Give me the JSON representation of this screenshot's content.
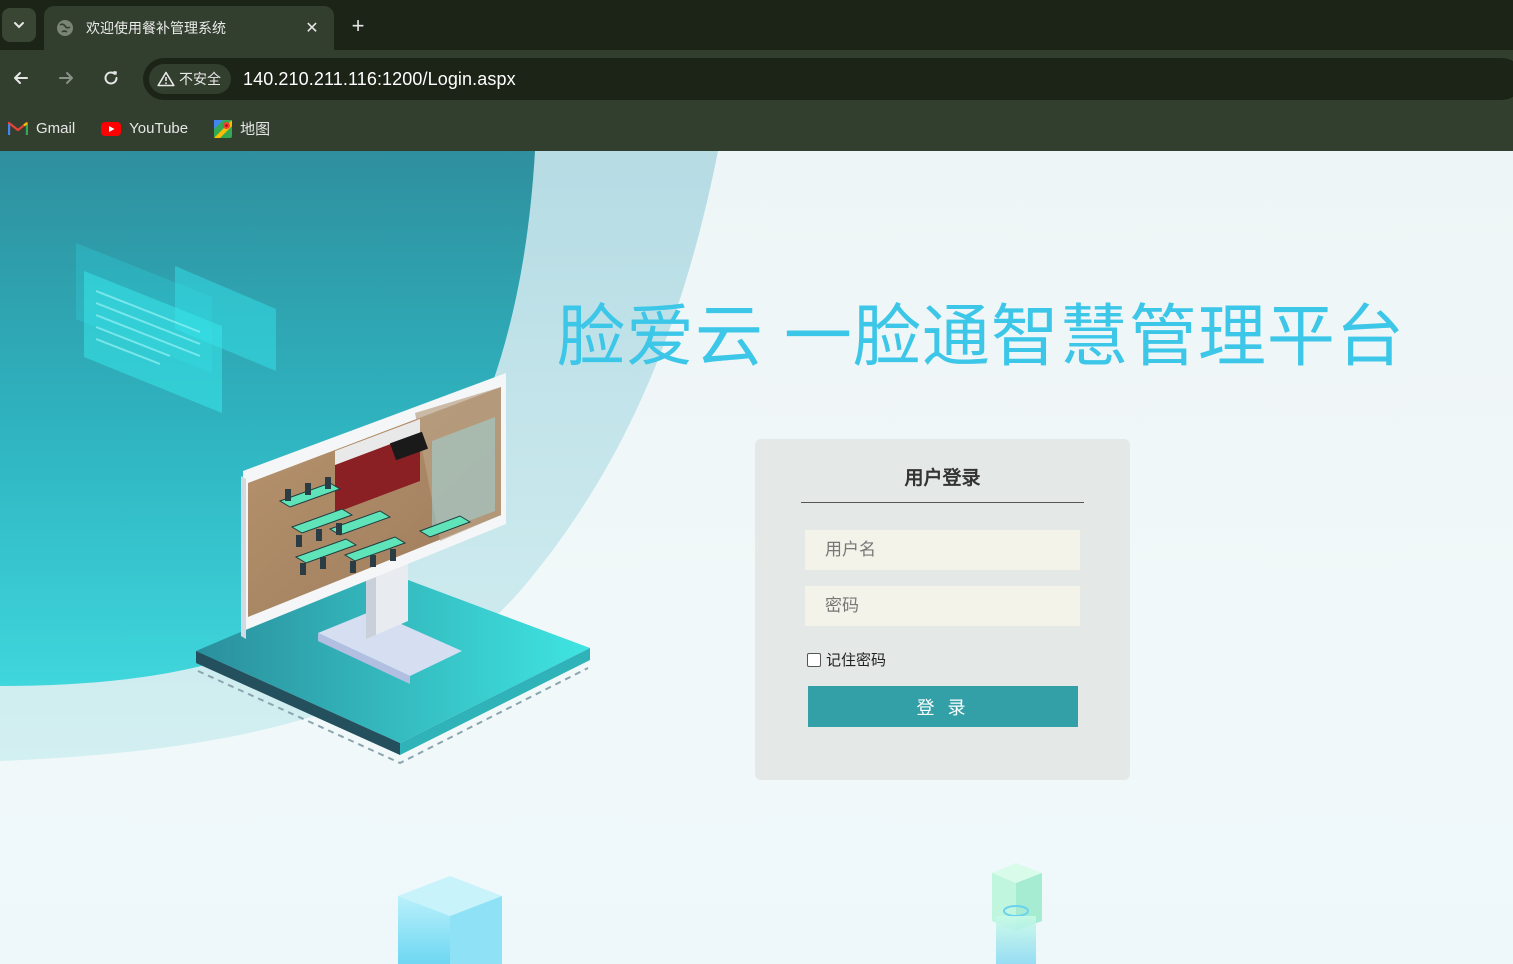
{
  "browser": {
    "tab": {
      "title": "欢迎使用餐补管理系统",
      "close_glyph": "✕"
    },
    "new_tab_glyph": "+",
    "omnibox": {
      "security_label": "不安全",
      "url": "140.210.211.116:1200/Login.aspx"
    },
    "bookmarks": [
      {
        "label": "Gmail",
        "icon": "gmail-icon"
      },
      {
        "label": "YouTube",
        "icon": "youtube-icon"
      },
      {
        "label": "地图",
        "icon": "maps-icon"
      }
    ],
    "colors": {
      "frame": "#1b2417",
      "toolbar": "#333f2e"
    }
  },
  "page": {
    "title": "脸爱云 一脸通智慧管理平台",
    "login": {
      "heading": "用户登录",
      "username_placeholder": "用户名",
      "password_placeholder": "密码",
      "remember_label": "记住密码",
      "remember_checked": false,
      "submit_label": "登 录"
    },
    "colors": {
      "title": "#3cc6e8",
      "button": "#33a0a8",
      "card": "#e4e8e7",
      "field": "#f3f3ea"
    }
  }
}
